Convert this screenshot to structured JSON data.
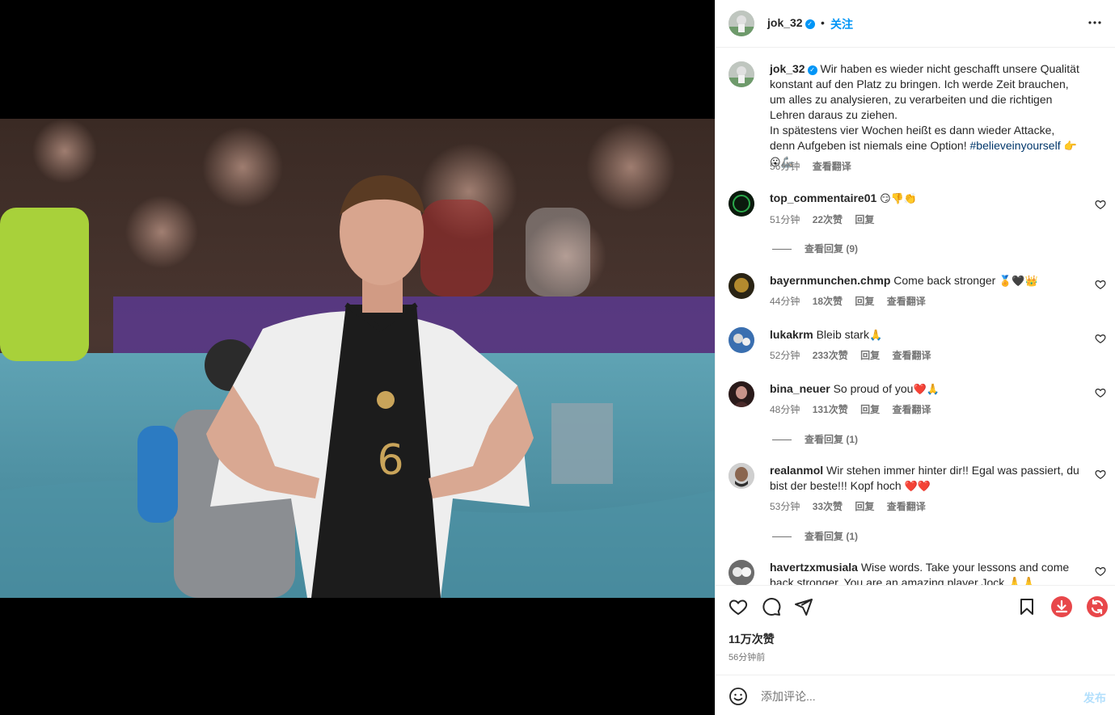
{
  "post": {
    "author": "jok_32",
    "follow_label": "关注",
    "dot": "•",
    "caption_line1": "Wir haben es wieder nicht geschafft unsere Qualität konstant auf den Platz zu bringen. Ich werde Zeit brauchen, um alles zu analysieren, zu verarbeiten und die richtigen Lehren daraus zu ziehen.",
    "caption_line2": "In spätestens vier Wochen heißt es dann wieder Attacke, denn Aufgeben ist niemals eine Option!",
    "hashtag": "#believeinyourself",
    "caption_emoji": "👉😮🦾",
    "caption_time": "56分钟",
    "translate_label": "查看翻译",
    "likes": "11万次赞",
    "posted_ago": "56分钟前",
    "jersey_number": "6"
  },
  "comments": [
    {
      "user": "top_commentaire01",
      "text": "",
      "emoji": "😏👎👏",
      "time": "51分钟",
      "likes": "22次赞",
      "reply": "回复",
      "translate": "",
      "replies": "查看回复 (9)"
    },
    {
      "user": "bayernmunchen.chmp",
      "text": "Come back stronger",
      "emoji": "🏅🖤👑",
      "time": "44分钟",
      "likes": "18次赞",
      "reply": "回复",
      "translate": "查看翻译",
      "replies": ""
    },
    {
      "user": "lukakrm",
      "text": "Bleib stark",
      "emoji": "🙏",
      "time": "52分钟",
      "likes": "233次赞",
      "reply": "回复",
      "translate": "查看翻译",
      "replies": ""
    },
    {
      "user": "bina_neuer",
      "text": "So proud of you",
      "emoji": "❤️🙏",
      "time": "48分钟",
      "likes": "131次赞",
      "reply": "回复",
      "translate": "查看翻译",
      "replies": "查看回复 (1)"
    },
    {
      "user": "realanmol",
      "text": "Wir stehen immer hinter dir!! Egal was passiert, du bist der beste!!! Kopf hoch",
      "emoji": "❤️❤️",
      "time": "53分钟",
      "likes": "33次赞",
      "reply": "回复",
      "translate": "查看翻译",
      "replies": "查看回复 (1)"
    },
    {
      "user": "havertzxmusiala",
      "text": "Wise words. Take your lessons and come back stronger. You are an amazing player Jock 🙏🙏",
      "emoji": "",
      "time": "",
      "likes": "",
      "reply": "",
      "translate": "",
      "replies": ""
    }
  ],
  "composer": {
    "placeholder": "添加评论...",
    "post_label": "发布"
  },
  "icons": {
    "header_more": "more-horizontal-icon",
    "like": "heart-icon",
    "comment": "comment-icon",
    "share": "share-icon",
    "save": "bookmark-icon",
    "download": "download-icon",
    "refresh": "refresh-icon",
    "emoji": "emoji-icon"
  },
  "colors": {
    "accent": "#0095f6",
    "download": "#e8474a",
    "refresh": "#e8474a"
  }
}
